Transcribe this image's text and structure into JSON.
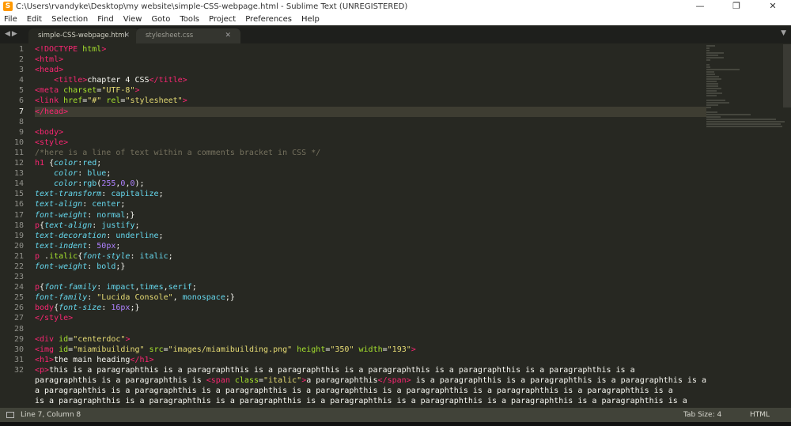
{
  "window": {
    "title": "C:\\Users\\rvandyke\\Desktop\\my website\\simple-CSS-webpage.html - Sublime Text (UNREGISTERED)"
  },
  "menu": [
    "File",
    "Edit",
    "Selection",
    "Find",
    "View",
    "Goto",
    "Tools",
    "Project",
    "Preferences",
    "Help"
  ],
  "tabs": [
    {
      "label": "simple-CSS-webpage.html",
      "active": true
    },
    {
      "label": "stylesheet.css",
      "active": false
    }
  ],
  "editor": {
    "current_line": 7,
    "lines": [
      [
        [
          "t",
          "<!DOCTYPE"
        ],
        [
          "w",
          " "
        ],
        [
          "a",
          "html"
        ],
        [
          "t",
          ">"
        ]
      ],
      [
        [
          "t",
          "<html>"
        ]
      ],
      [
        [
          "t",
          "<head>"
        ]
      ],
      [
        [
          "w",
          "    "
        ],
        [
          "t",
          "<title>"
        ],
        [
          "w",
          "chapter 4 CSS"
        ],
        [
          "t",
          "</title>"
        ]
      ],
      [
        [
          "t",
          "<meta"
        ],
        [
          "w",
          " "
        ],
        [
          "a",
          "charset"
        ],
        [
          "w",
          "="
        ],
        [
          "s",
          "\"UTF-8\""
        ],
        [
          "t",
          ">"
        ]
      ],
      [
        [
          "t",
          "<link"
        ],
        [
          "w",
          " "
        ],
        [
          "a",
          "href"
        ],
        [
          "w",
          "="
        ],
        [
          "s",
          "\"#\""
        ],
        [
          "w",
          " "
        ],
        [
          "a",
          "rel"
        ],
        [
          "w",
          "="
        ],
        [
          "s",
          "\"stylesheet\""
        ],
        [
          "t",
          ">"
        ]
      ],
      [
        [
          "t",
          "</head>"
        ]
      ],
      [],
      [
        [
          "t",
          "<body>"
        ]
      ],
      [
        [
          "t",
          "<style>"
        ]
      ],
      [
        [
          "c",
          "/*here is a line of text within a comments bracket in CSS */"
        ]
      ],
      [
        [
          "t",
          "h1"
        ],
        [
          "w",
          " {"
        ],
        [
          "p",
          "color"
        ],
        [
          "w",
          ":"
        ],
        [
          "v",
          "red"
        ],
        [
          "w",
          ";"
        ]
      ],
      [
        [
          "w",
          "    "
        ],
        [
          "p",
          "color"
        ],
        [
          "w",
          ": "
        ],
        [
          "v",
          "blue"
        ],
        [
          "w",
          ";"
        ]
      ],
      [
        [
          "w",
          "    "
        ],
        [
          "p",
          "color"
        ],
        [
          "w",
          ":"
        ],
        [
          "v",
          "rgb"
        ],
        [
          "w",
          "("
        ],
        [
          "n",
          "255"
        ],
        [
          "w",
          ","
        ],
        [
          "n",
          "0"
        ],
        [
          "w",
          ","
        ],
        [
          "n",
          "0"
        ],
        [
          "w",
          ");"
        ]
      ],
      [
        [
          "p",
          "text-transform"
        ],
        [
          "w",
          ": "
        ],
        [
          "v",
          "capitalize"
        ],
        [
          "w",
          ";"
        ]
      ],
      [
        [
          "p",
          "text-align"
        ],
        [
          "w",
          ": "
        ],
        [
          "v",
          "center"
        ],
        [
          "w",
          ";"
        ]
      ],
      [
        [
          "p",
          "font-weight"
        ],
        [
          "w",
          ": "
        ],
        [
          "v",
          "normal"
        ],
        [
          "w",
          ";}"
        ]
      ],
      [
        [
          "t",
          "p"
        ],
        [
          "w",
          "{"
        ],
        [
          "p",
          "text-align"
        ],
        [
          "w",
          ": "
        ],
        [
          "v",
          "justify"
        ],
        [
          "w",
          ";"
        ]
      ],
      [
        [
          "p",
          "text-decoration"
        ],
        [
          "w",
          ": "
        ],
        [
          "v",
          "underline"
        ],
        [
          "w",
          ";"
        ]
      ],
      [
        [
          "p",
          "text-indent"
        ],
        [
          "w",
          ": "
        ],
        [
          "n",
          "50px"
        ],
        [
          "w",
          ";"
        ]
      ],
      [
        [
          "t",
          "p"
        ],
        [
          "w",
          " ."
        ],
        [
          "a",
          "italic"
        ],
        [
          "w",
          "{"
        ],
        [
          "p",
          "font-style"
        ],
        [
          "w",
          ": "
        ],
        [
          "v",
          "italic"
        ],
        [
          "w",
          ";"
        ]
      ],
      [
        [
          "p",
          "font-weight"
        ],
        [
          "w",
          ": "
        ],
        [
          "v",
          "bold"
        ],
        [
          "w",
          ";}"
        ]
      ],
      [],
      [
        [
          "t",
          "p"
        ],
        [
          "w",
          "{"
        ],
        [
          "p",
          "font-family"
        ],
        [
          "w",
          ": "
        ],
        [
          "v",
          "impact"
        ],
        [
          "w",
          ","
        ],
        [
          "v",
          "times"
        ],
        [
          "w",
          ","
        ],
        [
          "v",
          "serif"
        ],
        [
          "w",
          ";"
        ]
      ],
      [
        [
          "p",
          "font-family"
        ],
        [
          "w",
          ": "
        ],
        [
          "s",
          "\"Lucida Console\""
        ],
        [
          "w",
          ", "
        ],
        [
          "v",
          "monospace"
        ],
        [
          "w",
          ";}"
        ]
      ],
      [
        [
          "t",
          "body"
        ],
        [
          "w",
          "{"
        ],
        [
          "p",
          "font-size"
        ],
        [
          "w",
          ": "
        ],
        [
          "n",
          "16px"
        ],
        [
          "w",
          ";}"
        ]
      ],
      [
        [
          "t",
          "</style>"
        ]
      ],
      [],
      [
        [
          "t",
          "<div"
        ],
        [
          "w",
          " "
        ],
        [
          "a",
          "id"
        ],
        [
          "w",
          "="
        ],
        [
          "s",
          "\"centerdoc\""
        ],
        [
          "t",
          ">"
        ]
      ],
      [
        [
          "t",
          "<img"
        ],
        [
          "w",
          " "
        ],
        [
          "a",
          "id"
        ],
        [
          "w",
          "="
        ],
        [
          "s",
          "\"miamibuilding\""
        ],
        [
          "w",
          " "
        ],
        [
          "a",
          "src"
        ],
        [
          "w",
          "="
        ],
        [
          "s",
          "\"images/miamibuilding.png\""
        ],
        [
          "w",
          " "
        ],
        [
          "a",
          "height"
        ],
        [
          "w",
          "="
        ],
        [
          "s",
          "\"350\""
        ],
        [
          "w",
          " "
        ],
        [
          "a",
          "width"
        ],
        [
          "w",
          "="
        ],
        [
          "s",
          "\"193\""
        ],
        [
          "t",
          ">"
        ]
      ],
      [
        [
          "t",
          "<h1>"
        ],
        [
          "w",
          "the main heading"
        ],
        [
          "t",
          "</h1>"
        ]
      ],
      [
        [
          "t",
          "<p>"
        ],
        [
          "w",
          "this is a paragraphthis is a paragraphthis is a paragraphthis is a paragraphthis is a paragraphthis is a paragraphthis is a"
        ]
      ],
      [
        [
          "w",
          "paragraphthis is a paragraphthis is "
        ],
        [
          "t",
          "<span"
        ],
        [
          "w",
          " "
        ],
        [
          "a",
          "class"
        ],
        [
          "w",
          "="
        ],
        [
          "s",
          "\"italic\""
        ],
        [
          "t",
          ">"
        ],
        [
          "w",
          "a paragraphthis"
        ],
        [
          "t",
          "</span>"
        ],
        [
          "w",
          " is a paragraphthis is a paragraphthis is a paragraphthis is a"
        ]
      ],
      [
        [
          "w",
          "a paragraphthis is a paragraphthis is a paragraphthis is a paragraphthis is a paragraphthis is a paragraphthis is a paragraphthis is a"
        ]
      ],
      [
        [
          "w",
          "is a paragraphthis is a paragraphthis is a paragraphthis is a paragraphthis is a paragraphthis is a paragraphthis is a paragraphthis is a"
        ]
      ]
    ],
    "line_numbers": [
      "1",
      "2",
      "3",
      "4",
      "5",
      "6",
      "7",
      "8",
      "9",
      "10",
      "11",
      "12",
      "13",
      "14",
      "15",
      "16",
      "17",
      "18",
      "19",
      "20",
      "21",
      "22",
      "23",
      "24",
      "25",
      "26",
      "27",
      "28",
      "29",
      "30",
      "31",
      "32",
      "",
      "",
      "",
      ""
    ]
  },
  "status": {
    "position": "Line 7, Column 8",
    "tab_size": "Tab Size: 4",
    "syntax": "HTML"
  },
  "colors": {
    "background": "#272822",
    "tag": "#f92672",
    "string": "#e6db74",
    "attribute": "#a6e22e",
    "property": "#66d9ef",
    "number": "#ae81ff",
    "comment": "#75715e"
  }
}
